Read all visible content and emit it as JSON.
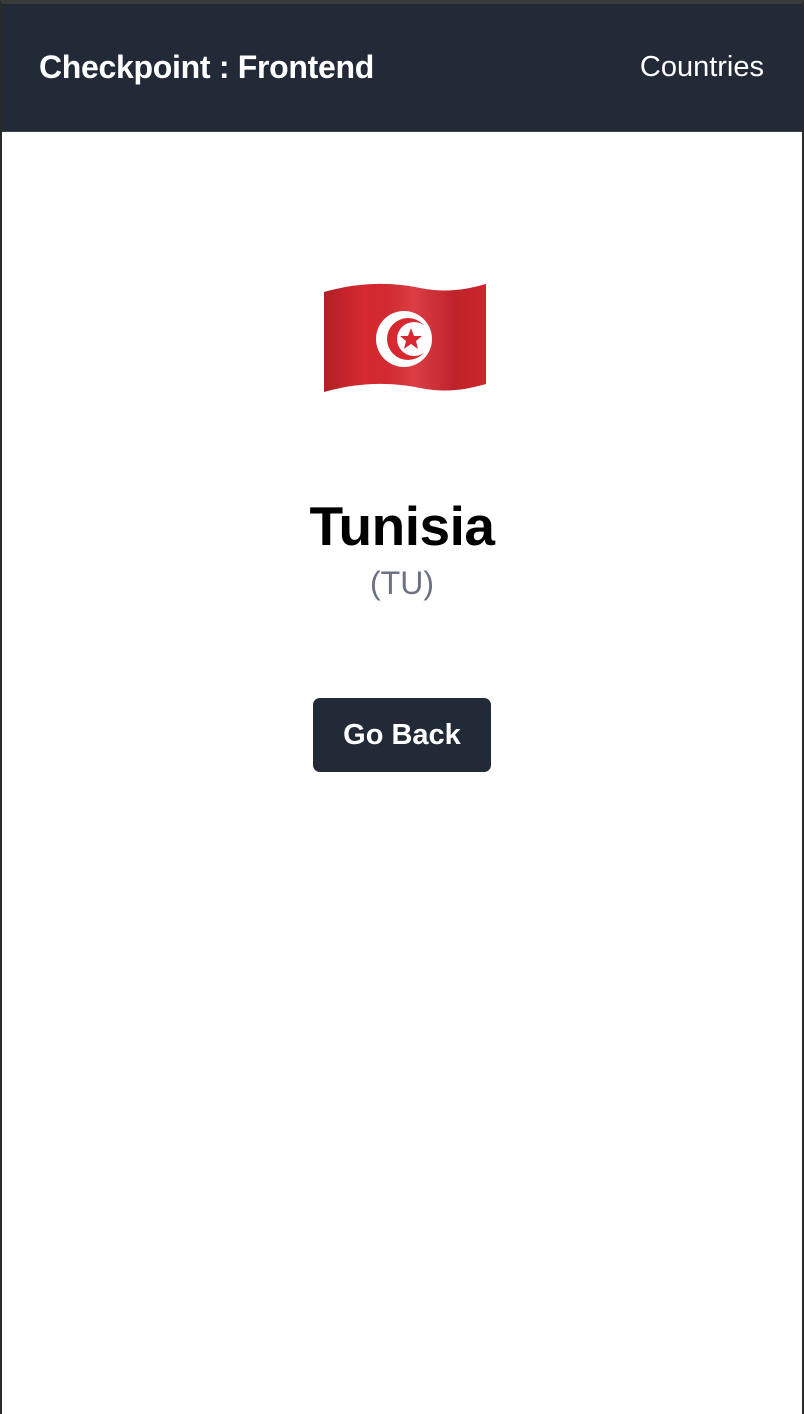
{
  "navbar": {
    "brand": "Checkpoint : Frontend",
    "countries_link": "Countries",
    "background_color": "#222937"
  },
  "country": {
    "flag_icon": "tunisia-flag-icon",
    "flag_colors": {
      "field": "#d7282f",
      "disc": "#ffffff",
      "crescent_and_star": "#d7282f"
    },
    "name": "Tunisia",
    "code": "(TU)"
  },
  "actions": {
    "go_back_label": "Go Back"
  },
  "colors": {
    "accent": "#222937",
    "code_text": "#6b7283"
  }
}
